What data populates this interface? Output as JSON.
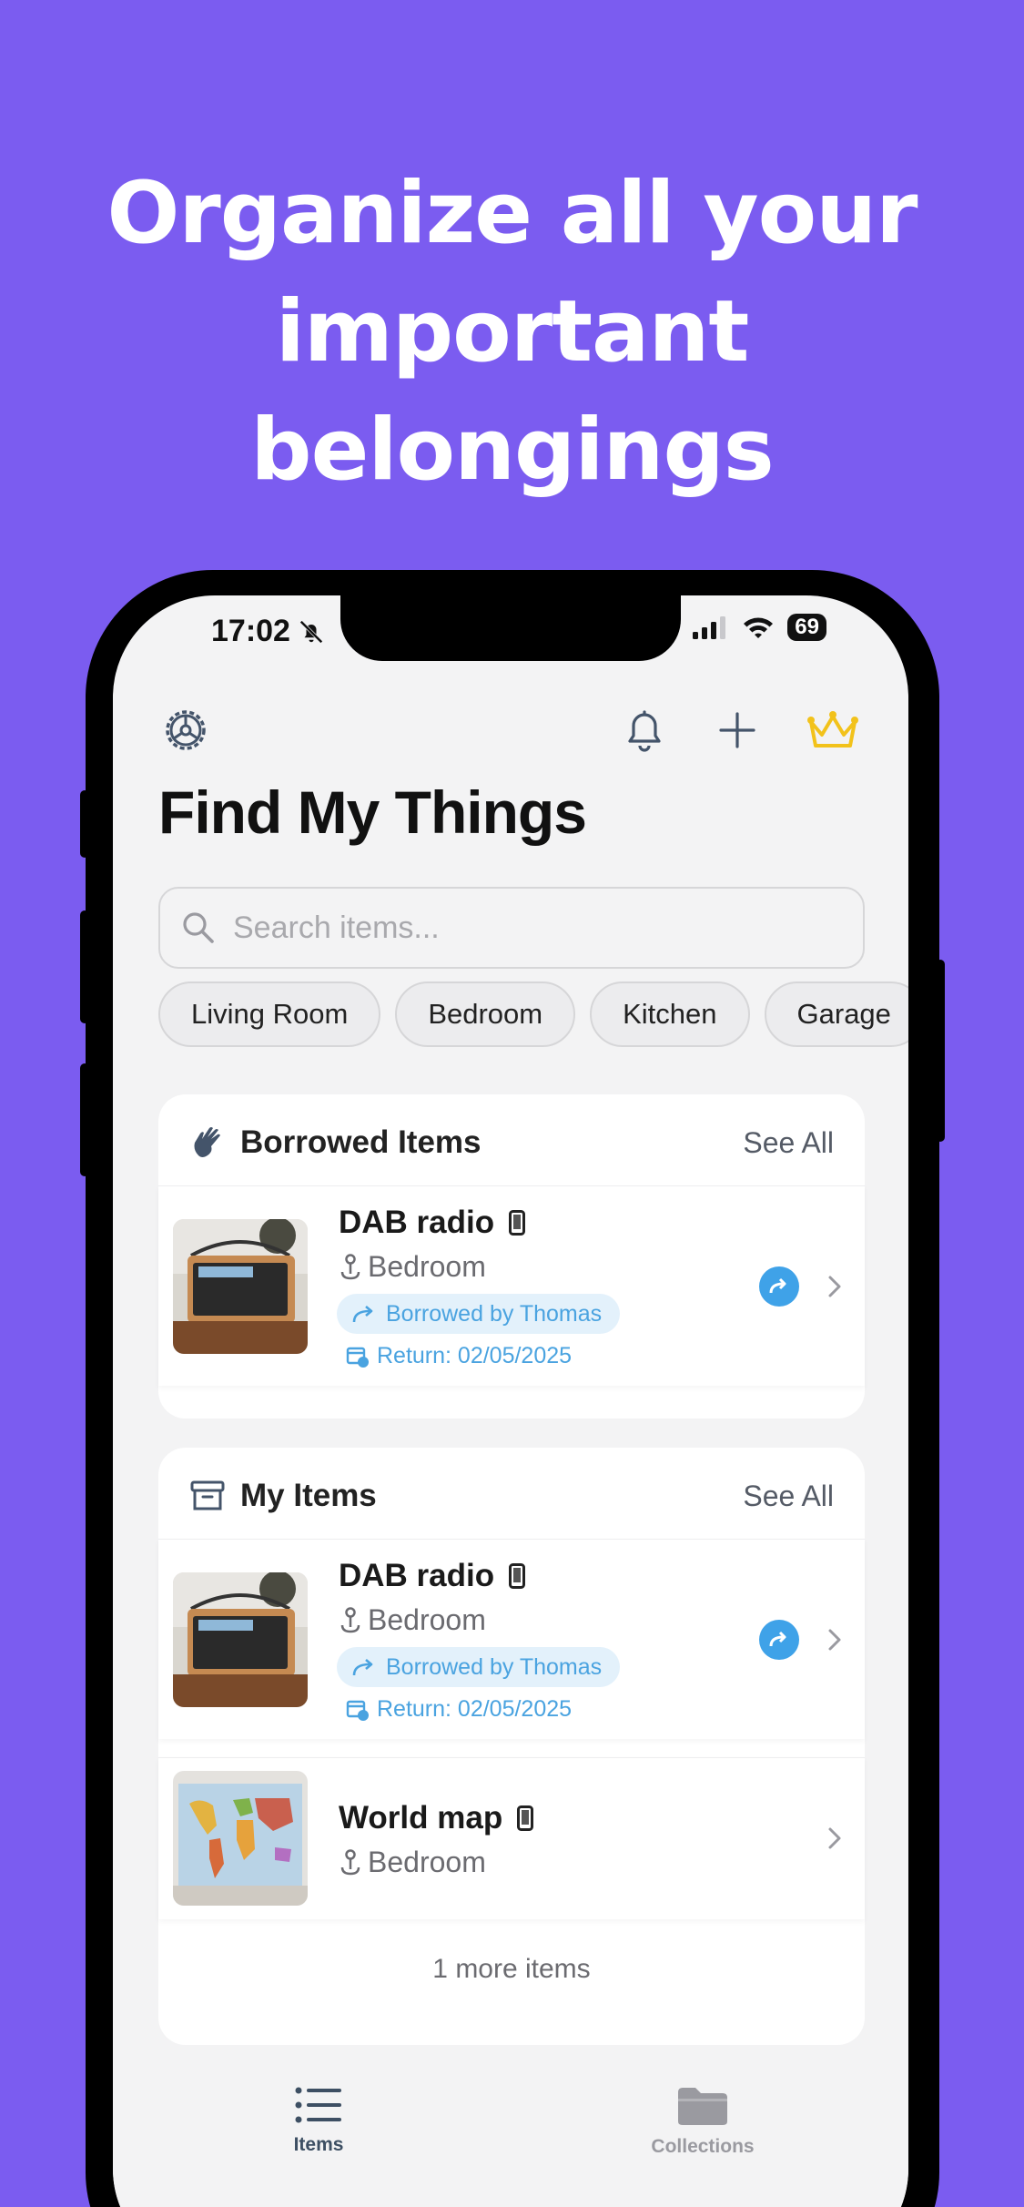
{
  "headline": {
    "line1": "Organize all your",
    "line2": "important",
    "line3": "belongings"
  },
  "status_bar": {
    "time": "17:02",
    "battery": "69"
  },
  "app": {
    "title": "Find My Things"
  },
  "search": {
    "placeholder": "Search items..."
  },
  "chips": [
    "Living Room",
    "Bedroom",
    "Kitchen",
    "Garage"
  ],
  "borrowed_section": {
    "title": "Borrowed Items",
    "see_all": "See All",
    "items": [
      {
        "name": "DAB radio",
        "location": "Bedroom",
        "borrowed_by": "Borrowed by Thomas",
        "return_date": "Return: 02/05/2025"
      }
    ]
  },
  "my_items_section": {
    "title": "My Items",
    "see_all": "See All",
    "items": [
      {
        "name": "DAB radio",
        "location": "Bedroom",
        "borrowed_by": "Borrowed by Thomas",
        "return_date": "Return: 02/05/2025"
      },
      {
        "name": "World map",
        "location": "Bedroom"
      }
    ],
    "more_items": "1 more items"
  },
  "tabs": [
    {
      "label": "Items",
      "icon": "list-icon",
      "active": true
    },
    {
      "label": "Collections",
      "icon": "folder-icon",
      "active": false
    }
  ],
  "colors": {
    "background": "#7b5cf0",
    "accent_blue": "#3fa2e8",
    "crown": "#f2c21b",
    "tab_active": "#3d4f63",
    "tab_inactive": "#9a9aa0"
  }
}
